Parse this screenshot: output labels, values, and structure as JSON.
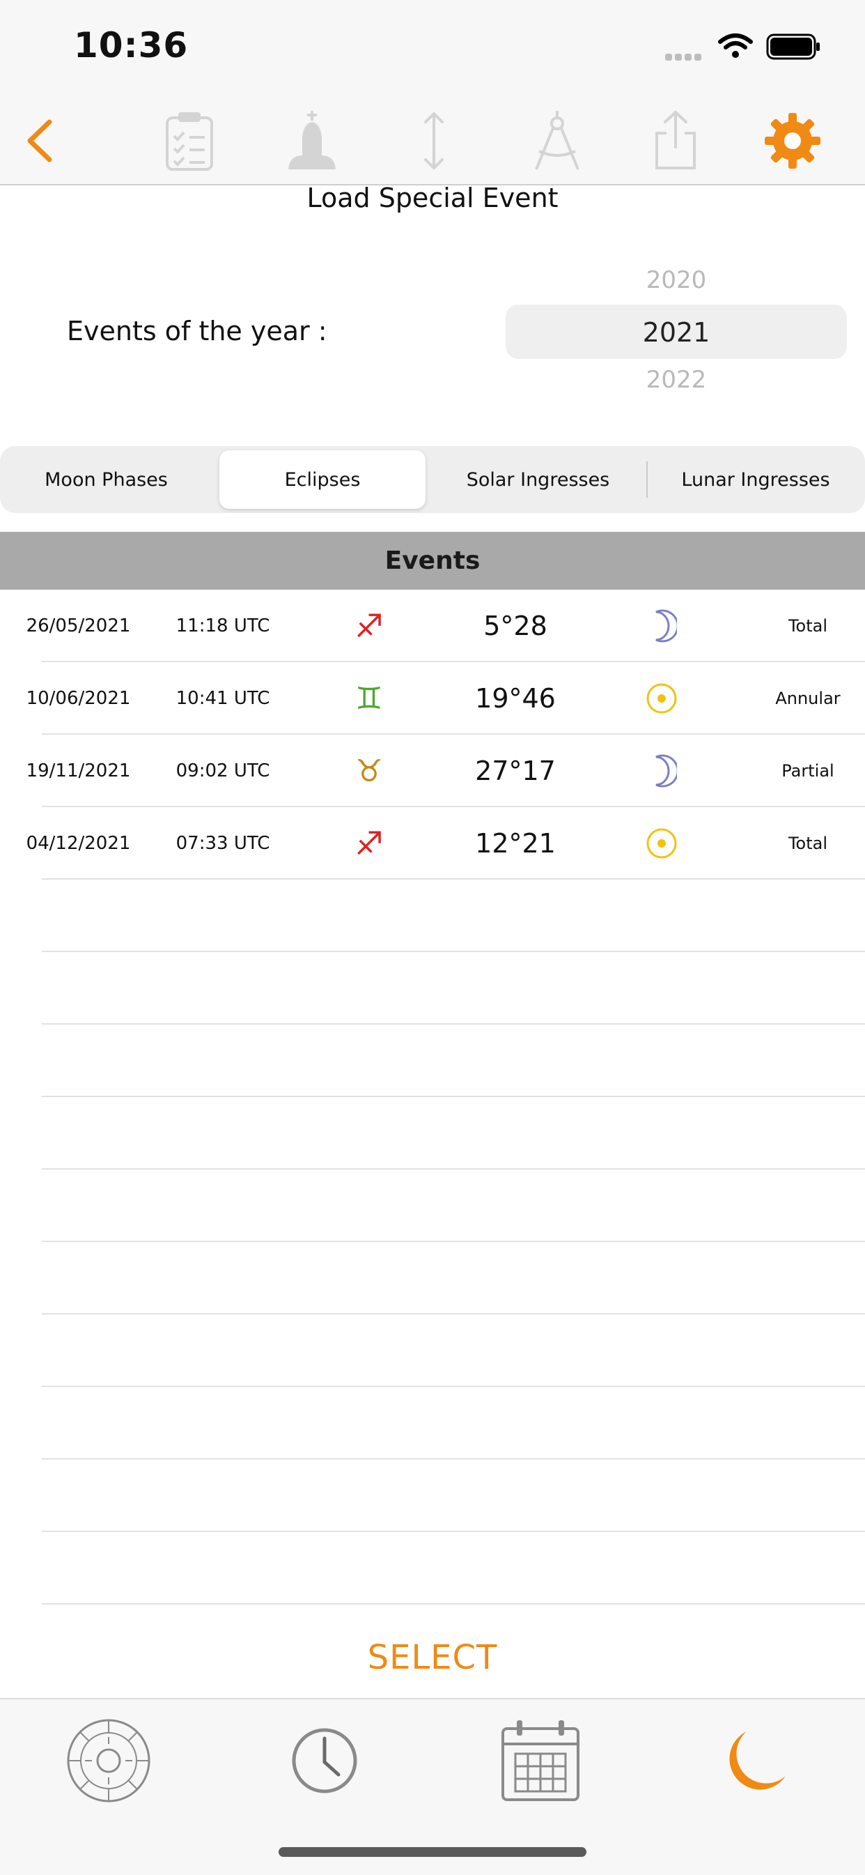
{
  "status": {
    "time": "10:36"
  },
  "toolbar": {
    "icons": [
      "back-chevron-icon",
      "clipboard-checklist-icon",
      "church-icon",
      "vertical-arrows-icon",
      "compass-icon",
      "share-icon",
      "gear-icon"
    ],
    "accent": "#f08a14"
  },
  "page": {
    "title": "Load Special Event"
  },
  "year_picker": {
    "label": "Events of the year :",
    "prev": "2020",
    "selected": "2021",
    "next": "2022"
  },
  "tabs": [
    {
      "label": "Moon Phases",
      "active": false
    },
    {
      "label": "Eclipses",
      "active": true
    },
    {
      "label": "Solar Ingresses",
      "active": false
    },
    {
      "label": "Lunar Ingresses",
      "active": false
    }
  ],
  "events": {
    "header": "Events",
    "rows": [
      {
        "date": "26/05/2021",
        "time": "11:18 UTC",
        "sign": "♐",
        "sign_name": "sagittarius-icon",
        "degree": "5°28",
        "body": "moon-icon",
        "kind": "Total"
      },
      {
        "date": "10/06/2021",
        "time": "10:41 UTC",
        "sign": "♊",
        "sign_name": "gemini-icon",
        "degree": "19°46",
        "body": "sun-icon",
        "kind": "Annular"
      },
      {
        "date": "19/11/2021",
        "time": "09:02 UTC",
        "sign": "♉",
        "sign_name": "taurus-icon",
        "degree": "27°17",
        "body": "moon-icon",
        "kind": "Partial"
      },
      {
        "date": "04/12/2021",
        "time": "07:33 UTC",
        "sign": "♐",
        "sign_name": "sagittarius-icon",
        "degree": "12°21",
        "body": "sun-icon",
        "kind": "Total"
      }
    ]
  },
  "select_label": "SELECT",
  "tabbar": {
    "icons": [
      "zodiac-wheel-icon",
      "clock-icon",
      "calendar-icon",
      "crescent-moon-icon"
    ]
  }
}
